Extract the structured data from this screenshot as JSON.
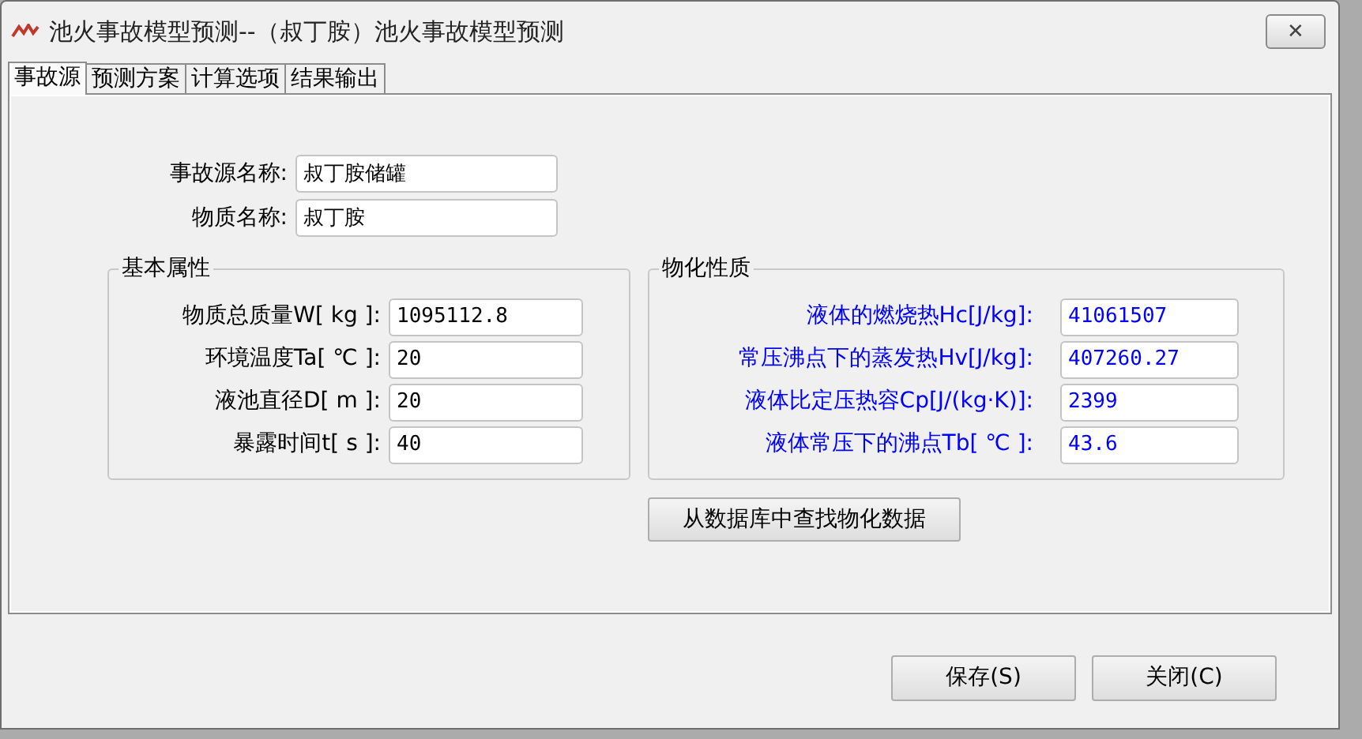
{
  "window": {
    "title": "池火事故模型预测--（叔丁胺）池火事故模型预测",
    "close": "✕"
  },
  "tabs": [
    {
      "label": "事故源",
      "selected": true
    },
    {
      "label": "预测方案",
      "selected": false
    },
    {
      "label": "计算选项",
      "selected": false
    },
    {
      "label": "结果输出",
      "selected": false
    }
  ],
  "source_fields": [
    {
      "label": "事故源名称:",
      "value": "叔丁胺储罐"
    },
    {
      "label": "物质名称:",
      "value": "叔丁胺"
    }
  ],
  "basic_properties": {
    "title": "基本属性",
    "fields": [
      {
        "label": "物质总质量W[ kg ]:",
        "value": "1095112.8"
      },
      {
        "label": "环境温度Ta[ ℃ ]:",
        "value": "20"
      },
      {
        "label": "液池直径D[  m ]:",
        "value": "20"
      },
      {
        "label": "暴露时间t[ s ]:",
        "value": "40"
      }
    ]
  },
  "physchem_properties": {
    "title": "物化性质",
    "fields": [
      {
        "label": "液体的燃烧热Hc[J/kg]:",
        "value": "41061507"
      },
      {
        "label": "常压沸点下的蒸发热Hv[J/kg]:",
        "value": "407260.27"
      },
      {
        "label": "液体比定压热容Cp[J/(kg·K)]:",
        "value": "2399"
      },
      {
        "label": "液体常压下的沸点Tb[ ℃ ]:",
        "value": "43.6"
      }
    ]
  },
  "lookup_button": "从数据库中查找物化数据",
  "buttons": [
    "保存(S)",
    "关闭(C)"
  ]
}
